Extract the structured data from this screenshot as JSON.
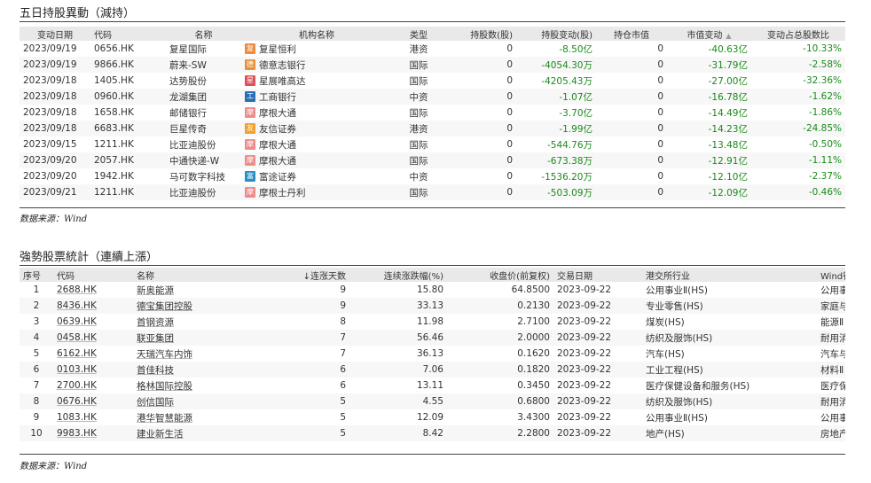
{
  "section1": {
    "title": "五日持股異動（減持）",
    "headers": [
      "变动日期",
      "代码",
      "名称",
      "机构名称",
      "类型",
      "持股数(股)",
      "持股变动(股)",
      "持仓市值",
      "市值变动",
      "变动占总股数比"
    ],
    "sort_indicator": "▲",
    "rows": [
      {
        "date": "2023/09/19",
        "code": "0656.HK",
        "name": "复星国际",
        "inst": "复星恒利",
        "inst_icon": "复",
        "inst_color": "#f08a3c",
        "type": "港资",
        "shares": "0",
        "change": "-8.50亿",
        "mv": "0",
        "mv_change": "-40.63亿",
        "pct": "-10.33%"
      },
      {
        "date": "2023/09/19",
        "code": "9866.HK",
        "name": "蔚来-SW",
        "inst": "德意志银行",
        "inst_icon": "德",
        "inst_color": "#e8913a",
        "type": "国际",
        "shares": "0",
        "change": "-4054.30万",
        "mv": "0",
        "mv_change": "-31.79亿",
        "pct": "-2.58%"
      },
      {
        "date": "2023/09/18",
        "code": "1405.HK",
        "name": "达势股份",
        "inst": "星展唯高达",
        "inst_icon": "星",
        "inst_color": "#e0505a",
        "type": "国际",
        "shares": "0",
        "change": "-4205.43万",
        "mv": "0",
        "mv_change": "-27.00亿",
        "pct": "-32.36%"
      },
      {
        "date": "2023/09/18",
        "code": "0960.HK",
        "name": "龙湖集团",
        "inst": "工商银行",
        "inst_icon": "工",
        "inst_color": "#2a6fb4",
        "type": "中资",
        "shares": "0",
        "change": "-1.07亿",
        "mv": "0",
        "mv_change": "-16.78亿",
        "pct": "-1.62%"
      },
      {
        "date": "2023/09/18",
        "code": "1658.HK",
        "name": "邮储银行",
        "inst": "摩根大通",
        "inst_icon": "摩",
        "inst_color": "#ee8c8c",
        "type": "国际",
        "shares": "0",
        "change": "-3.70亿",
        "mv": "0",
        "mv_change": "-14.49亿",
        "pct": "-1.86%"
      },
      {
        "date": "2023/09/18",
        "code": "6683.HK",
        "name": "巨星传奇",
        "inst": "友信证券",
        "inst_icon": "友",
        "inst_color": "#f0a030",
        "type": "港资",
        "shares": "0",
        "change": "-1.99亿",
        "mv": "0",
        "mv_change": "-14.23亿",
        "pct": "-24.85%"
      },
      {
        "date": "2023/09/15",
        "code": "1211.HK",
        "name": "比亚迪股份",
        "inst": "摩根大通",
        "inst_icon": "摩",
        "inst_color": "#ee8c8c",
        "type": "国际",
        "shares": "0",
        "change": "-544.76万",
        "mv": "0",
        "mv_change": "-13.48亿",
        "pct": "-0.50%"
      },
      {
        "date": "2023/09/20",
        "code": "2057.HK",
        "name": "中通快递-W",
        "inst": "摩根大通",
        "inst_icon": "摩",
        "inst_color": "#ee8c8c",
        "type": "国际",
        "shares": "0",
        "change": "-673.38万",
        "mv": "0",
        "mv_change": "-12.91亿",
        "pct": "-1.11%"
      },
      {
        "date": "2023/09/20",
        "code": "1942.HK",
        "name": "马可数字科技",
        "inst": "富途证券",
        "inst_icon": "富",
        "inst_color": "#2a8fc4",
        "type": "中资",
        "shares": "0",
        "change": "-1536.20万",
        "mv": "0",
        "mv_change": "-12.10亿",
        "pct": "-2.37%"
      },
      {
        "date": "2023/09/21",
        "code": "1211.HK",
        "name": "比亚迪股份",
        "inst": "摩根士丹利",
        "inst_icon": "摩",
        "inst_color": "#ee8c8c",
        "type": "国际",
        "shares": "0",
        "change": "-503.09万",
        "mv": "0",
        "mv_change": "-12.09亿",
        "pct": "-0.46%"
      }
    ],
    "source": "数据来源：Wind"
  },
  "section2": {
    "title": "強勢股票統計（連續上漲）",
    "headers": [
      "序号",
      "代码",
      "名称",
      "↓连涨天数",
      "连续涨跌幅(%)",
      "收盘价(前复权)",
      "交易日期",
      "港交所行业",
      "Wind行业"
    ],
    "rows": [
      {
        "no": "1",
        "code": "2688.HK",
        "name": "新奥能源",
        "days": "9",
        "pct": "15.80",
        "close": "64.8500",
        "date": "2023-09-22",
        "hk_ind": "公用事业Ⅱ(HS)",
        "wind_ind": "公用事业Ⅱ"
      },
      {
        "no": "2",
        "code": "8436.HK",
        "name": "德宝集团控股",
        "days": "9",
        "pct": "33.13",
        "close": "0.2130",
        "date": "2023-09-22",
        "hk_ind": "专业零售(HS)",
        "wind_ind": "家庭与个人用品"
      },
      {
        "no": "3",
        "code": "0639.HK",
        "name": "首钢资源",
        "days": "8",
        "pct": "11.98",
        "close": "2.7100",
        "date": "2023-09-22",
        "hk_ind": "煤炭(HS)",
        "wind_ind": "能源Ⅱ"
      },
      {
        "no": "4",
        "code": "0458.HK",
        "name": "联亚集团",
        "days": "7",
        "pct": "56.46",
        "close": "2.0000",
        "date": "2023-09-22",
        "hk_ind": "纺织及服饰(HS)",
        "wind_ind": "耐用消费品与服装"
      },
      {
        "no": "5",
        "code": "6162.HK",
        "name": "天瑞汽车内饰",
        "days": "7",
        "pct": "36.13",
        "close": "0.1620",
        "date": "2023-09-22",
        "hk_ind": "汽车(HS)",
        "wind_ind": "汽车与汽车零部件"
      },
      {
        "no": "6",
        "code": "0103.HK",
        "name": "首佳科技",
        "days": "6",
        "pct": "7.06",
        "close": "0.1820",
        "date": "2023-09-22",
        "hk_ind": "工业工程(HS)",
        "wind_ind": "材料Ⅱ"
      },
      {
        "no": "7",
        "code": "2700.HK",
        "name": "格林国际控股",
        "days": "6",
        "pct": "13.11",
        "close": "0.3450",
        "date": "2023-09-22",
        "hk_ind": "医疗保健设备和服务(HS)",
        "wind_ind": "医疗保健设备与服务"
      },
      {
        "no": "8",
        "code": "0676.HK",
        "name": "创信国际",
        "days": "5",
        "pct": "4.55",
        "close": "0.6800",
        "date": "2023-09-22",
        "hk_ind": "纺织及服饰(HS)",
        "wind_ind": "耐用消费品与服装"
      },
      {
        "no": "9",
        "code": "1083.HK",
        "name": "港华智慧能源",
        "days": "5",
        "pct": "12.09",
        "close": "3.4300",
        "date": "2023-09-22",
        "hk_ind": "公用事业Ⅱ(HS)",
        "wind_ind": "公用事业Ⅱ"
      },
      {
        "no": "10",
        "code": "9983.HK",
        "name": "建业新生活",
        "days": "5",
        "pct": "8.42",
        "close": "2.2800",
        "date": "2023-09-22",
        "hk_ind": "地产(HS)",
        "wind_ind": "房地产Ⅱ"
      }
    ],
    "source": "数据来源：Wind"
  }
}
